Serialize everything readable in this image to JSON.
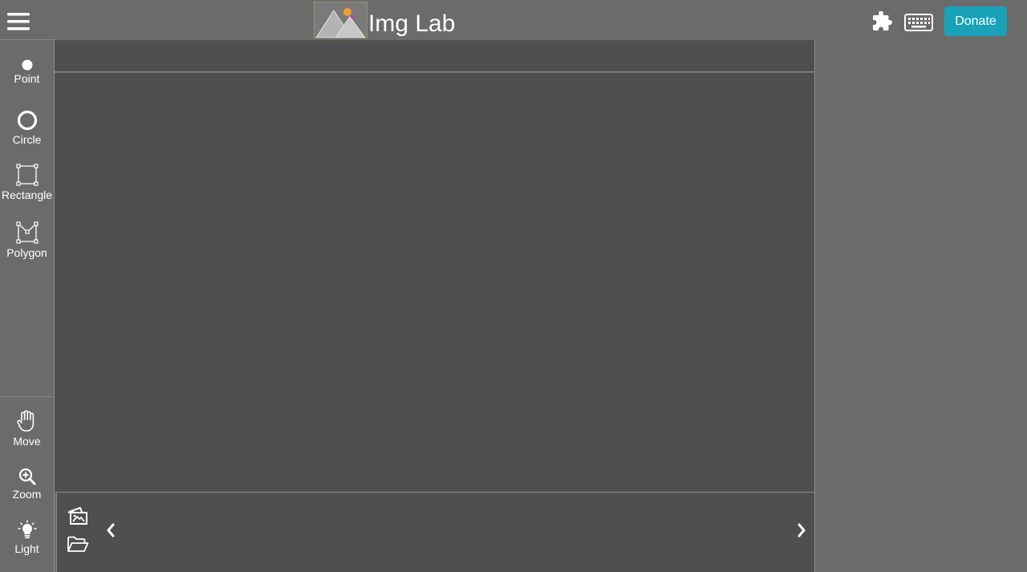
{
  "header": {
    "title": "Img Lab",
    "donate_label": "Donate"
  },
  "tools": {
    "point": "Point",
    "circle": "Circle",
    "rectangle": "Rectangle",
    "polygon": "Polygon",
    "move": "Move",
    "zoom": "Zoom",
    "light": "Light"
  },
  "icons": {
    "menu": "hamburger-icon",
    "logo": "mountain-logo",
    "plugins": "puzzle-icon",
    "shortcuts": "keyboard-icon",
    "add_images": "images-icon",
    "open_folder": "folder-open-icon",
    "prev": "chevron-left-icon",
    "next": "chevron-right-icon"
  },
  "colors": {
    "background": "#6b6b6b",
    "workspace": "#4f4f4f",
    "donate": "#17a2b8",
    "logo_sun": "#f0a030",
    "logo_dot": "#b43cc8"
  }
}
